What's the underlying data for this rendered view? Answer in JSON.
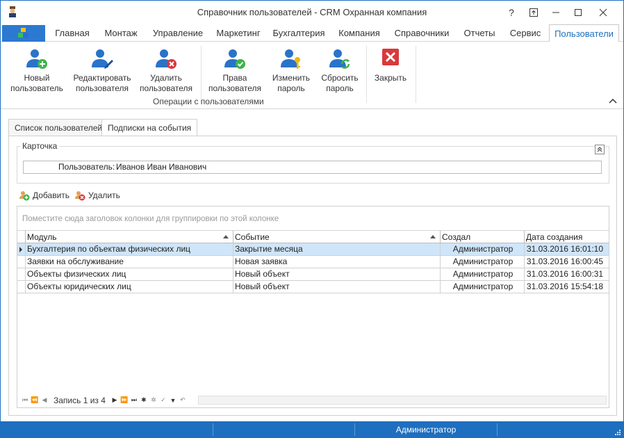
{
  "window": {
    "title": "Справочник пользователей - CRM Охранная компания",
    "help_label": "?",
    "colors": {
      "accent": "#1e6fbf",
      "selection": "#cfe5f9"
    }
  },
  "ribbon": {
    "tabs": [
      "Главная",
      "Монтаж",
      "Управление",
      "Маркетинг",
      "Бухгалтерия",
      "Компания",
      "Справочники",
      "Отчеты",
      "Сервис",
      "Пользователи"
    ],
    "active_tab": "Пользователи",
    "buttons": {
      "new_user": {
        "line1": "Новый",
        "line2": "пользователь",
        "icon": "user-add-icon"
      },
      "edit_user": {
        "line1": "Редактировать",
        "line2": "пользователя",
        "icon": "user-edit-icon"
      },
      "delete_user": {
        "line1": "Удалить",
        "line2": "пользователя",
        "icon": "user-delete-icon"
      },
      "rights": {
        "line1": "Права",
        "line2": "пользователя",
        "icon": "user-check-icon"
      },
      "change_password": {
        "line1": "Изменить",
        "line2": "пароль",
        "icon": "user-key-icon"
      },
      "reset_password": {
        "line1": "Сбросить",
        "line2": "пароль",
        "icon": "user-refresh-icon"
      },
      "close": {
        "line1": "Закрыть",
        "icon": "close-red-icon"
      }
    },
    "group_label": "Операции с пользователями"
  },
  "page_tabs": [
    "Список пользователей",
    "Подписки на события"
  ],
  "active_page_tab": "Подписки на события",
  "card": {
    "title": "Карточка",
    "user_label": "Пользователь:",
    "user_value": "Иванов Иван Иванович"
  },
  "grid_toolbar": {
    "add_label": "Добавить",
    "delete_label": "Удалить"
  },
  "grid": {
    "group_panel_text": "Поместите сюда заголовок колонки для группировки по этой колонке",
    "columns": [
      "Модуль",
      "Событие",
      "Создал",
      "Дата создания"
    ],
    "rows": [
      {
        "module": "Бухгалтерия по объектам физических лиц",
        "event": "Закрытие месяца",
        "created_by": "Администратор",
        "created_at": "31.03.2016 16:01:10"
      },
      {
        "module": "Заявки на обслуживание",
        "event": "Новая заявка",
        "created_by": "Администратор",
        "created_at": "31.03.2016 16:00:45"
      },
      {
        "module": "Объекты физических лиц",
        "event": "Новый объект",
        "created_by": "Администратор",
        "created_at": "31.03.2016 16:00:31"
      },
      {
        "module": "Объекты юридических лиц",
        "event": "Новый объект",
        "created_by": "Администратор",
        "created_at": "31.03.2016 15:54:18"
      }
    ],
    "selected_row": 0,
    "navigator_text": "Запись 1 из 4"
  },
  "statusbar": {
    "user": "Администратор"
  }
}
